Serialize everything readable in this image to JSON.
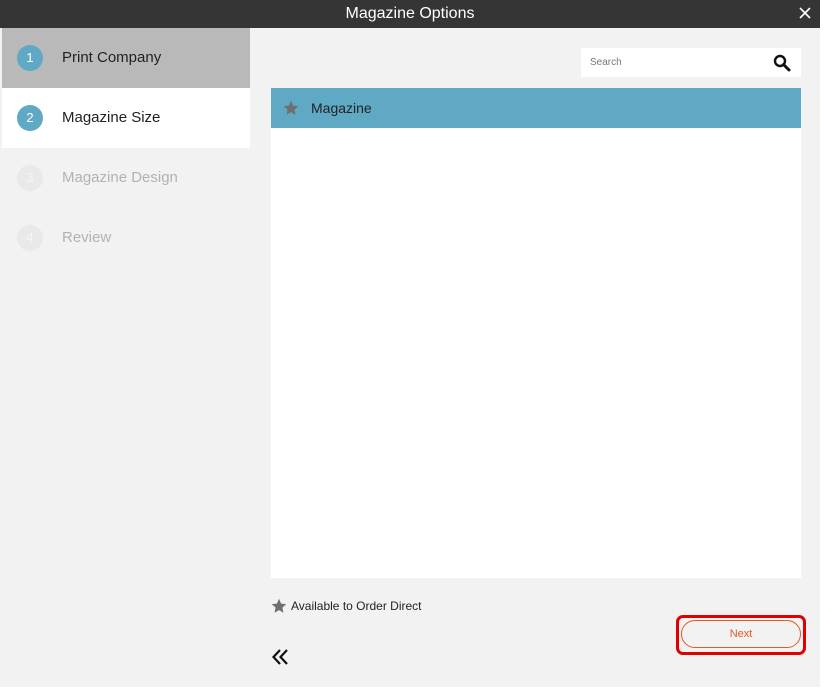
{
  "window": {
    "title": "Magazine Options",
    "close_icon": "close-icon"
  },
  "sidebar": {
    "steps": [
      {
        "number": "1",
        "label": "Print Company",
        "state": "completed"
      },
      {
        "number": "2",
        "label": "Magazine Size",
        "state": "current"
      },
      {
        "number": "3",
        "label": "Magazine Design",
        "state": "disabled"
      },
      {
        "number": "4",
        "label": "Review",
        "state": "disabled"
      }
    ]
  },
  "main": {
    "search": {
      "placeholder": "Search",
      "value": "",
      "icon": "search-icon"
    },
    "list": {
      "items": [
        {
          "label": "Magazine",
          "icon": "star-icon",
          "selected": true
        }
      ]
    },
    "legend": {
      "icon": "star-icon",
      "label": "Available to Order Direct"
    },
    "back_icon": "double-chevron-left-icon",
    "next_label": "Next"
  },
  "colors": {
    "titlebar": "#353535",
    "accent_blue": "#60a9c5",
    "completed_step": "#b9b9b9",
    "next_orange": "#e35b1e",
    "highlight_red": "#e10000"
  }
}
